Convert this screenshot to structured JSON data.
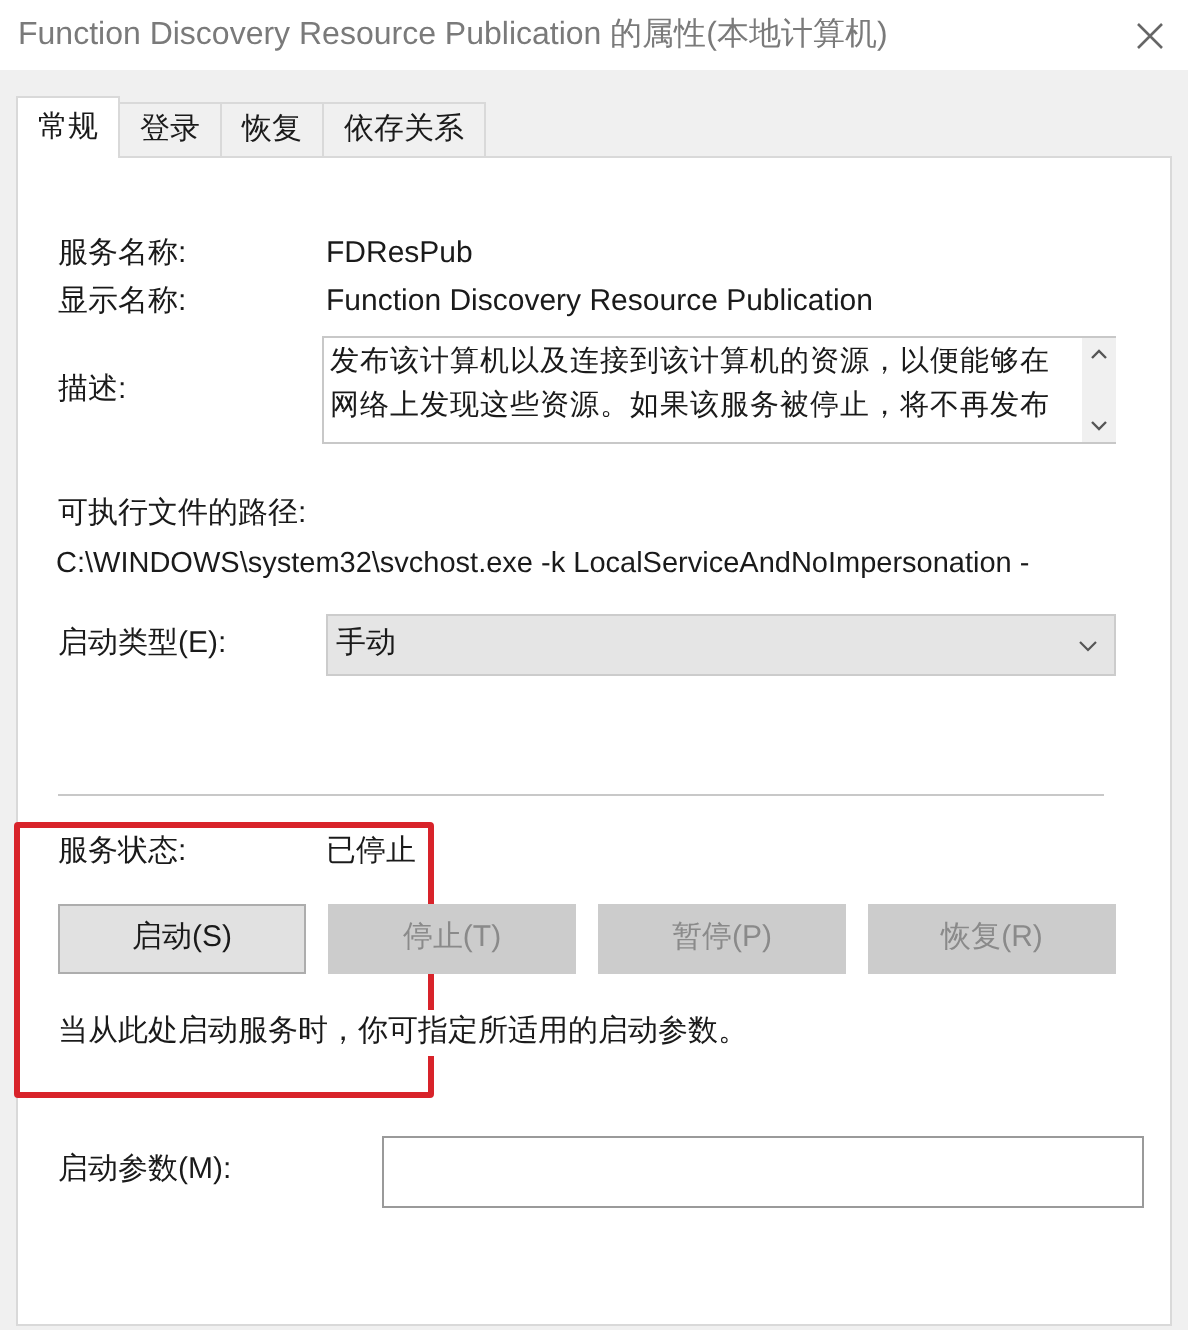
{
  "window": {
    "title": "Function Discovery Resource Publication 的属性(本地计算机)"
  },
  "tabs": [
    {
      "label": "常规",
      "selected": true
    },
    {
      "label": "登录",
      "selected": false
    },
    {
      "label": "恢复",
      "selected": false
    },
    {
      "label": "依存关系",
      "selected": false
    }
  ],
  "service_name": {
    "label": "服务名称:",
    "value": "FDResPub"
  },
  "display_name": {
    "label": "显示名称:",
    "value": "Function Discovery Resource Publication"
  },
  "description": {
    "label": "描述:",
    "lines": [
      "发布该计算机以及连接到该计算机的资源，以便能够在",
      "网络上发现这些资源。如果该服务被停止，将不再发布"
    ]
  },
  "executable_path": {
    "label": "可执行文件的路径:",
    "value": "C:\\WINDOWS\\system32\\svchost.exe -k LocalServiceAndNoImpersonation -"
  },
  "startup_type": {
    "label": "启动类型(E):",
    "value": "手动"
  },
  "service_status": {
    "label": "服务状态:",
    "value": "已停止"
  },
  "buttons": [
    {
      "label": "启动(S)",
      "disabled": false
    },
    {
      "label": "停止(T)",
      "disabled": true
    },
    {
      "label": "暂停(P)",
      "disabled": true
    },
    {
      "label": "恢复(R)",
      "disabled": true
    }
  ],
  "hint": "当从此处启动服务时，你可指定所适用的启动参数。",
  "start_parameters": {
    "label": "启动参数(M):"
  }
}
